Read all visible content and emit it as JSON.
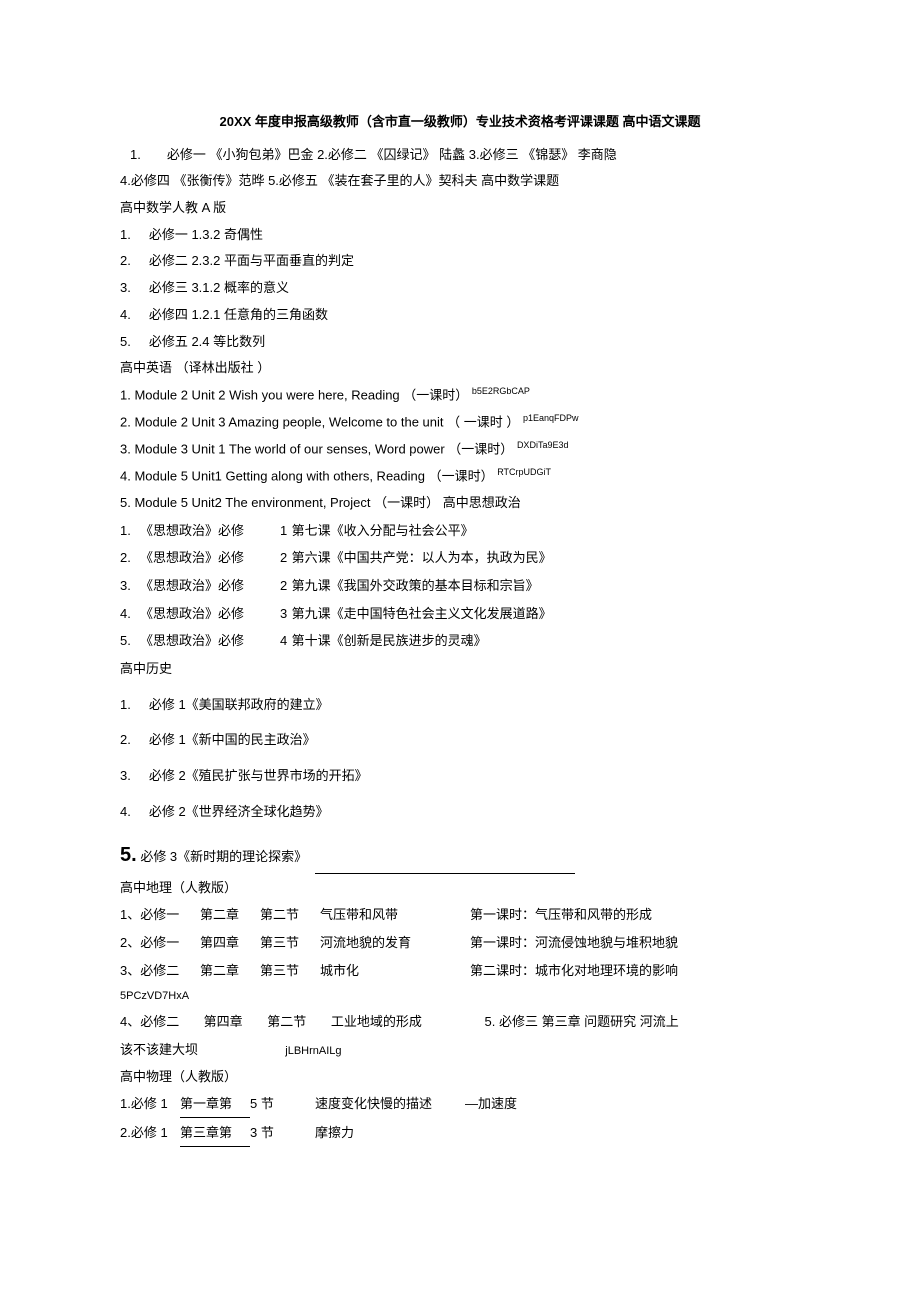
{
  "title": "20XX 年度申报高级教师（含市直一级教师）专业技术资格考评课课题 高中语文课题",
  "chinese_intro_line": "1.　　必修一 《小狗包弟》巴金 2.必修二 《囚绿记》 陆蠡 3.必修三 《锦瑟》 李商隐",
  "chinese_line2": "4.必修四 《张衡传》范晔 5.必修五 《装在套子里的人》契科夫 高中数学课题",
  "math_head": "高中数学人教 A 版",
  "math_items": [
    "必修一 1.3.2 奇偶性",
    "必修二 2.3.2 平面与平面垂直的判定",
    "必修三 3.1.2 概率的意义",
    "必修四 1.2.1 任意角的三角函数",
    "必修五 2.4 等比数列"
  ],
  "english_head": "高中英语 （译林出版社 ）",
  "english_items": [
    {
      "n": "1.",
      "t": "Module 2 Unit 2 Wish you were here, Reading （一课时）",
      "sup": "b5E2RGbCAP"
    },
    {
      "n": "2.",
      "t": "Module 2 Unit 3 Amazing people, Welcome to the unit （ 一课时 ）",
      "sup": "p1EanqFDPw"
    },
    {
      "n": "3.",
      "t": "Module 3 Unit 1 The world of our senses, Word power （一课时）",
      "sup": "DXDiTa9E3d"
    },
    {
      "n": "4.",
      "t": "Module 5 Unit1 Getting along with others, Reading （一课时）",
      "sup": "RTCrpUDGiT"
    }
  ],
  "english_line5": "5. Module 5 Unit2 The environment, Project （一课时） 高中思想政治",
  "politics_items": [
    {
      "n": "1.",
      "book": "《思想政治》必修",
      "vol": "1",
      "title": "第七课《收入分配与社会公平》"
    },
    {
      "n": "2.",
      "book": "《思想政治》必修",
      "vol": "2",
      "title": "第六课《中国共产党：以人为本，执政为民》"
    },
    {
      "n": "3.",
      "book": "《思想政治》必修",
      "vol": "2",
      "title": "第九课《我国外交政策的基本目标和宗旨》"
    },
    {
      "n": "4.",
      "book": "《思想政治》必修",
      "vol": "3",
      "title": "第九课《走中国特色社会主义文化发展道路》"
    },
    {
      "n": "5.",
      "book": "《思想政治》必修",
      "vol": "4",
      "title": "第十课《创新是民族进步的灵魂》"
    }
  ],
  "history_head": "高中历史",
  "history_items": [
    "必修 1《美国联邦政府的建立》",
    "必修 1《新中国的民主政治》",
    "必修 2《殖民扩张与世界市场的开拓》",
    "必修 2《世界经济全球化趋势》"
  ],
  "history_item5_prefix": "5.",
  "history_item5_text": "必修 3《新时期的理论探索》",
  "geo_head": "高中地理（人教版）",
  "geo_rows": [
    {
      "c1": "1、必修一",
      "c2": "第二章",
      "c3": "第二节",
      "c4": "气压带和风带",
      "c5": "第一课时：气压带和风带的形成"
    },
    {
      "c1": "2、必修一",
      "c2": "第四章",
      "c3": "第三节",
      "c4": "河流地貌的发育",
      "c5": "第一课时：河流侵蚀地貌与堆积地貌"
    },
    {
      "c1": "3、必修二",
      "c2": "第二章",
      "c3": "第三节",
      "c4": "城市化",
      "c5": "第二课时：城市化对地理环境的影响"
    }
  ],
  "geo_code1": "5PCzVD7HxA",
  "geo_row4": {
    "c1": "4、必修二",
    "c2": "第四章",
    "c3": "第二节",
    "c4": "工业地域的形成",
    "c5": "5. 必修三 第三章 问题研究 河流上"
  },
  "geo_tail_a": "该不该建大坝",
  "geo_tail_b": "jLBHrnAILg",
  "phys_head": "高中物理（人教版）",
  "phys_rows": [
    {
      "c1": "1.必修 1",
      "c2": "第一章第",
      "c3": "5 节",
      "c4": "速度变化快慢的描述",
      "c5": "—加速度"
    },
    {
      "c1": "2.必修 1",
      "c2": "第三章第",
      "c3": "3 节",
      "c4": "摩擦力",
      "c5": ""
    }
  ]
}
